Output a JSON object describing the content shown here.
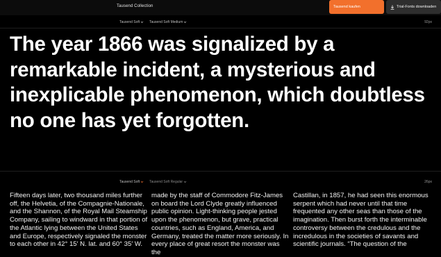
{
  "topbar": {
    "collection_title": "Tausend Collection",
    "buy_label": "Tausend kaufen",
    "trial_label": "Trial-Fonts downloaden",
    "trial_icon": "download-icon",
    "buy_color": "#f2702c"
  },
  "specimen_large": {
    "family_label": "Tausend Soft",
    "style_label": "Tausend Soft Medium",
    "size_label": "92px",
    "text": "The year 1866 was signalized by a remarkable incident, a mysterious and inexplicable phenomenon, which doubtless no one has yet forgotten."
  },
  "specimen_body": {
    "family_label": "Tausend Soft",
    "style_label": "Tausend Soft Regular",
    "size_label": "26px",
    "columns": [
      "Fifteen days later, two thousand miles further off, the Helvetia, of the Compagnie-Nationale, and the Shannon, of the Royal Mail Steamship Company, sailing to windward in that portion of the Atlantic lying between the United States and Europe, respectively signaled the monster to each other in 42° 15′ N. lat. and 60° 35′ W.",
      "made by the staff of Commodore Fitz-James on board the Lord Clyde greatly influenced public opinion. Light-thinking people jested upon the phenomenon, but grave, practical countries, such as England, America, and Germany, treated the matter more seriously. In every place of great resort the monster was the",
      "Castillan, in 1857, he had seen this enormous serpent which had never until that time frequented any other seas than those of the imagination. Then burst forth the interminable controversy between the credulous and the incredulous in the societies of savants and scientific journals. “The question of the"
    ]
  }
}
